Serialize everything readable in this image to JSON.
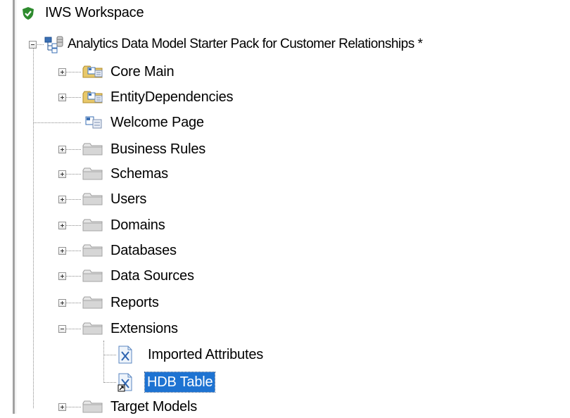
{
  "tree": {
    "root": {
      "label": "IWS Workspace",
      "icon": "shield-check-icon",
      "color": "#2e8b2e"
    },
    "project": {
      "label": "Analytics Data Model Starter Pack for Customer Relationships *",
      "icon": "model-tree-icon",
      "expanded": true
    },
    "items": [
      {
        "label": "Core Main",
        "icon": "diagram-folder-icon",
        "expanded": false
      },
      {
        "label": "EntityDependencies",
        "icon": "diagram-folder-icon",
        "expanded": false
      },
      {
        "label": "Welcome Page",
        "icon": "diagram-page-icon"
      },
      {
        "label": "Business Rules",
        "icon": "folder-icon",
        "expanded": false
      },
      {
        "label": "Schemas",
        "icon": "folder-icon",
        "expanded": false
      },
      {
        "label": "Users",
        "icon": "folder-icon",
        "expanded": false
      },
      {
        "label": "Domains",
        "icon": "folder-icon",
        "expanded": false
      },
      {
        "label": "Databases",
        "icon": "folder-icon",
        "expanded": false
      },
      {
        "label": "Data Sources",
        "icon": "folder-icon",
        "expanded": false
      },
      {
        "label": "Reports",
        "icon": "folder-icon",
        "expanded": false
      },
      {
        "label": "Extensions",
        "icon": "folder-icon",
        "expanded": true
      },
      {
        "label": "Target Models",
        "icon": "folder-icon",
        "expanded": false
      }
    ],
    "extensions_children": [
      {
        "label": "Imported Attributes",
        "icon": "extension-doc-icon",
        "selected": false
      },
      {
        "label": "HDB Table",
        "icon": "extension-doc-shortcut-icon",
        "selected": true
      }
    ],
    "selection_color": "#1e73d2"
  }
}
